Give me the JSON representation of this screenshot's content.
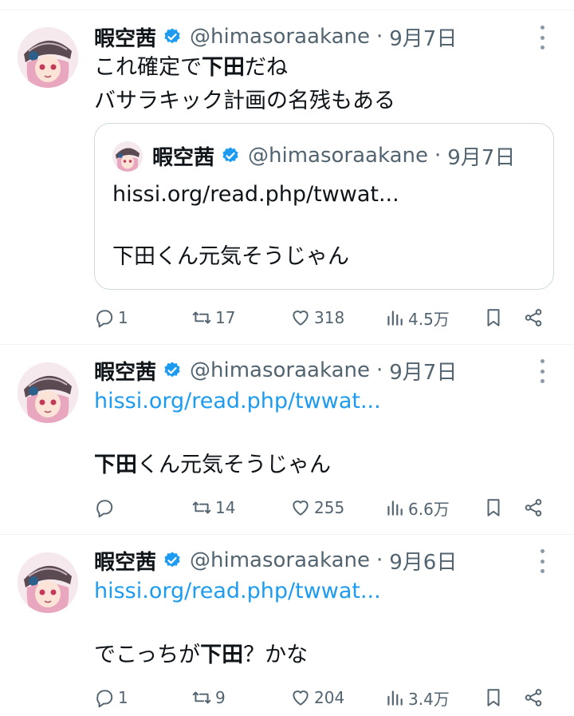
{
  "account": {
    "display_name": "暇空茜",
    "handle": "@himasoraakane",
    "verified_icon": "verified-badge-icon"
  },
  "colors": {
    "link": "#1d9bf0",
    "muted": "#536471",
    "text": "#0f1419",
    "verified": "#1d9bf0"
  },
  "tweets": [
    {
      "date": "9月7日",
      "text_line1_pre": "これ確定で",
      "text_line1_bold": "下田",
      "text_line1_post": "だね",
      "text_line2": "バサラキック計画の名残もある",
      "quote": {
        "display_name": "暇空茜",
        "handle": "@himasoraakane",
        "date": "9月7日",
        "link": "hissi.org/read.php/twwat...",
        "text": "下田くん元気そうじゃん"
      },
      "metrics": {
        "replies": "1",
        "retweets": "17",
        "likes": "318",
        "views": "4.5万"
      }
    },
    {
      "date": "9月7日",
      "link": "hissi.org/read.php/twwat...",
      "text_bold": "下田",
      "text_post": "くん元気そうじゃん",
      "metrics": {
        "replies": "",
        "retweets": "14",
        "likes": "255",
        "views": "6.6万"
      }
    },
    {
      "date": "9月6日",
      "link": "hissi.org/read.php/twwat...",
      "text_pre": "でこっちが",
      "text_bold": "下田",
      "text_post": "？かな",
      "metrics": {
        "replies": "1",
        "retweets": "9",
        "likes": "204",
        "views": "3.4万"
      }
    }
  ]
}
